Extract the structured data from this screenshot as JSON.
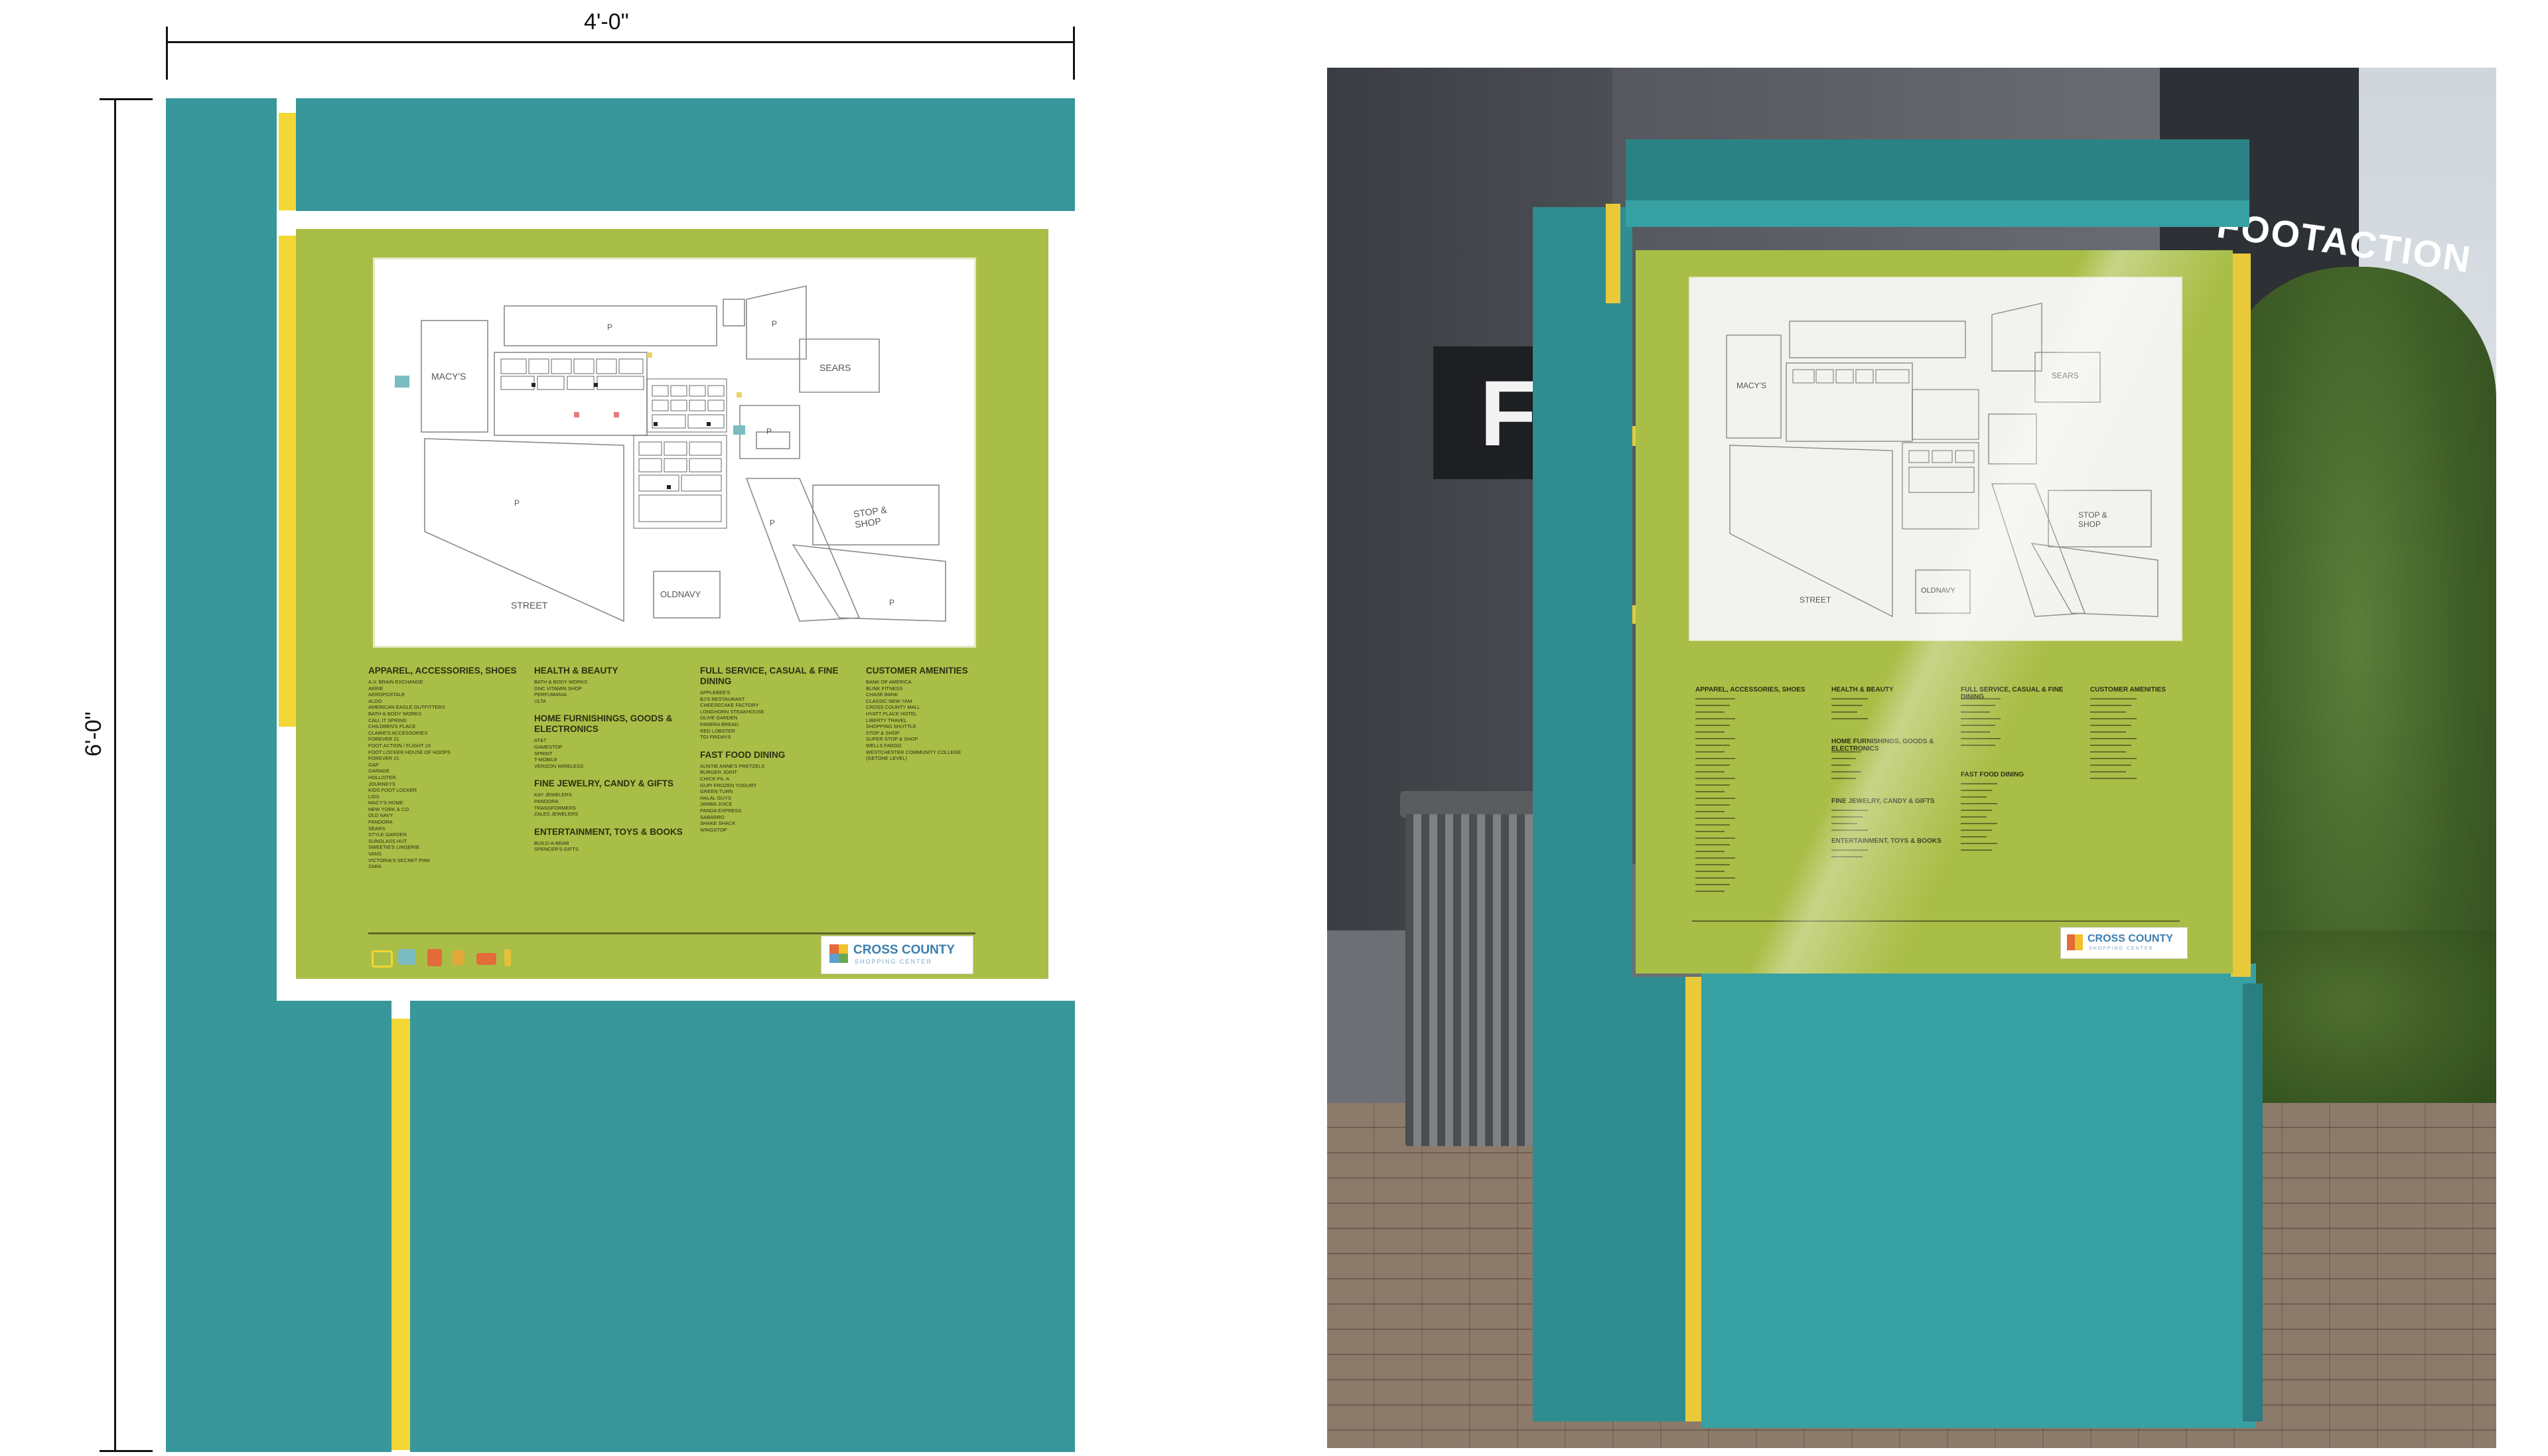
{
  "dimensions": {
    "width_label": "4'-0\"",
    "height_label": "6'-0\""
  },
  "map_labels": {
    "macys": "MACY'S",
    "sears": "SEARS",
    "stop_shop": "STOP &\nSHOP",
    "old_navy": "OLDNAVY",
    "street": "STREET",
    "parking": "P"
  },
  "directory": {
    "columns": [
      {
        "sections": [
          {
            "heading": "APPAREL, ACCESSORIES, SHOES",
            "items": [
              "A.V. BRAIN EXCHANGE",
              "AERIE",
              "AEROPOSTALE",
              "ALDO",
              "AMERICAN EAGLE OUTFITTERS",
              "BATH & BODY WORKS",
              "CALL IT SPRING",
              "CHILDREN'S PLACE",
              "CLAIRE'S ACCESSORIES",
              "FOREVER 21",
              "FOOT ACTION / FLIGHT 23",
              "FOOT LOCKER HOUSE OF HOOPS",
              "FOREVER 21",
              "GAP",
              "GARAGE",
              "HOLLISTER",
              "JOURNEYS",
              "KIDS FOOT LOCKER",
              "LIDS",
              "MACY'S HOME",
              "NEW YORK & CO.",
              "OLD NAVY",
              "PANDORA",
              "SEARS",
              "STYLE GARDEN",
              "SUNGLASS HUT",
              "SWEETIE'S LINGERIE",
              "VANS",
              "VICTORIA'S SECRET PINK",
              "ZARA"
            ]
          }
        ]
      },
      {
        "sections": [
          {
            "heading": "HEALTH & BEAUTY",
            "items": [
              "BATH & BODY WORKS",
              "GNC VITAMIN SHOP",
              "PERFUMANIA",
              "ULTA"
            ]
          },
          {
            "heading": "HOME FURNISHINGS, GOODS & ELECTRONICS",
            "items": [
              "AT&T",
              "GAMESTOP",
              "SPRINT",
              "T-MOBILE",
              "VERIZON WIRELESS"
            ]
          },
          {
            "heading": "FINE JEWELRY, CANDY & GIFTS",
            "items": [
              "KAY JEWELERS",
              "PANDORA",
              "TRANSFORMERS",
              "ZALES JEWELERS"
            ]
          },
          {
            "heading": "ENTERTAINMENT, TOYS & BOOKS",
            "items": [
              "BUILD-A-BEAR",
              "SPENCER'S GIFTS"
            ]
          }
        ]
      },
      {
        "sections": [
          {
            "heading": "FULL SERVICE, CASUAL & FINE DINING",
            "items": [
              "APPLEBEE'S",
              "BJ'S RESTAURANT",
              "CHEESECAKE FACTORY",
              "LONGHORN STEAKHOUSE",
              "OLIVE GARDEN",
              "PANERA BREAD",
              "RED LOBSTER",
              "TGI FRIDAYS"
            ]
          },
          {
            "heading": "FAST FOOD DINING",
            "items": [
              "AUNTIE ANNE'S PRETZELS",
              "BURGER JOINT",
              "CHICK-FIL-A",
              "GUPI FROZEN YOGURT",
              "GREEN TURN",
              "HALAL GUYS",
              "JAMBA JUICE",
              "PANDA EXPRESS",
              "SABARRO",
              "SHAKE SHACK",
              "WINGSTOP"
            ]
          }
        ]
      },
      {
        "sections": [
          {
            "heading": "CUSTOMER AMENITIES",
            "items": [
              "BANK OF AMERICA",
              "BLINK FITNESS",
              "CHASE BANK",
              "CLASSIC NEW YAM",
              "CROSS COUNTY MALL",
              "HYATT PLACE HOTEL",
              "LIBERTY TRAVEL",
              "SHOPPING SHUTTLE",
              "STOP & SHOP",
              "SUPER STOP & SHOP",
              "WELLS FARGO",
              "WESTCHESTER COMMUNITY COLLEGE",
              "(GETONE LEVEL)"
            ]
          }
        ]
      }
    ]
  },
  "logo": {
    "name": "CROSS COUNTY",
    "subtitle": "SHOPPING CENTER",
    "colors": [
      "#e36b3a",
      "#f2c12e",
      "#5aa0d0",
      "#6aa84f"
    ]
  },
  "photo_signage": {
    "store_sign_partial": "F",
    "footaction_sign": "FOOTACTION"
  },
  "colors": {
    "teal": "#38979a",
    "yellow": "#f2d735",
    "lime": "#a9be47"
  }
}
